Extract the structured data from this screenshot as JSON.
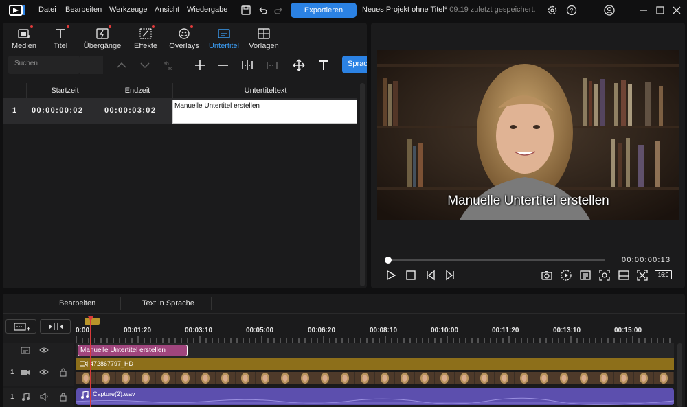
{
  "menu": [
    "Datei",
    "Bearbeiten",
    "Werkzeuge",
    "Ansicht",
    "Wiedergabe"
  ],
  "export_label": "Exportieren",
  "project": {
    "title": "Neues Projekt ohne Titel*",
    "saved": "09:19 zuletzt gespeichert."
  },
  "tabs": [
    {
      "label": "Medien",
      "icon": "media-icon",
      "dot": true
    },
    {
      "label": "Titel",
      "icon": "title-icon",
      "dot": true
    },
    {
      "label": "Übergänge",
      "icon": "transitions-icon",
      "dot": true
    },
    {
      "label": "Effekte",
      "icon": "effects-icon",
      "dot": true
    },
    {
      "label": "Overlays",
      "icon": "overlays-icon",
      "dot": true
    },
    {
      "label": "Untertitel",
      "icon": "subtitles-icon",
      "dot": false,
      "active": true
    },
    {
      "label": "Vorlagen",
      "icon": "templates-icon",
      "dot": false
    }
  ],
  "search_placeholder": "Suchen",
  "sprache_label": "Sprach",
  "table": {
    "headers": [
      "Startzeit",
      "Endzeit",
      "Untertiteltext"
    ],
    "rows": [
      {
        "index": "1",
        "start": "00:00:00:02",
        "end": "00:00:03:02",
        "text": "Manuelle Untertitel erstellen"
      }
    ]
  },
  "preview": {
    "caption": "Manuelle Untertitel erstellen",
    "timecode": "00:00:00:13",
    "aspect": "16:9",
    "progress": 0.0
  },
  "timeline_tabs": [
    "Bearbeiten",
    "Text in Sprache"
  ],
  "ruler": [
    "0:00",
    "00:01:20",
    "00:03:10",
    "00:05:00",
    "00:06:20",
    "00:08:10",
    "00:10:00",
    "00:11:20",
    "00:13:10",
    "00:15:00"
  ],
  "tracks": {
    "subtitle_clip": "Manuelle Untertitel erstellen",
    "video_number": "1",
    "video_clip": "472867797_HD",
    "audio_number": "1",
    "audio_clip": "Capture(2).wav"
  },
  "colors": {
    "accent": "#2b82e4",
    "subtitle_clip": "#a0457d",
    "video_clip": "#8d6f1a",
    "audio_clip": "#5c4fae",
    "playhead": "#d83a3a"
  }
}
